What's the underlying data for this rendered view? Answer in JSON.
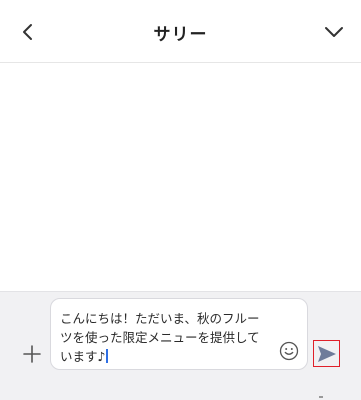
{
  "header": {
    "title": "サリー",
    "back_icon": "chevron-left-icon",
    "menu_icon": "chevron-down-icon"
  },
  "composer": {
    "message_text": "こんにちは！ただいま、秋のフルー\nツを使った限定メニューを提供して\nいます♪",
    "plus_icon": "plus-icon",
    "emoji_icon": "smiley-icon",
    "send_icon": "send-icon"
  },
  "colors": {
    "send_arrow": "#6f7c9a",
    "send_highlight": "#e0202a",
    "caret": "#2f6fe4",
    "composer_bg": "#f1f1f3"
  }
}
